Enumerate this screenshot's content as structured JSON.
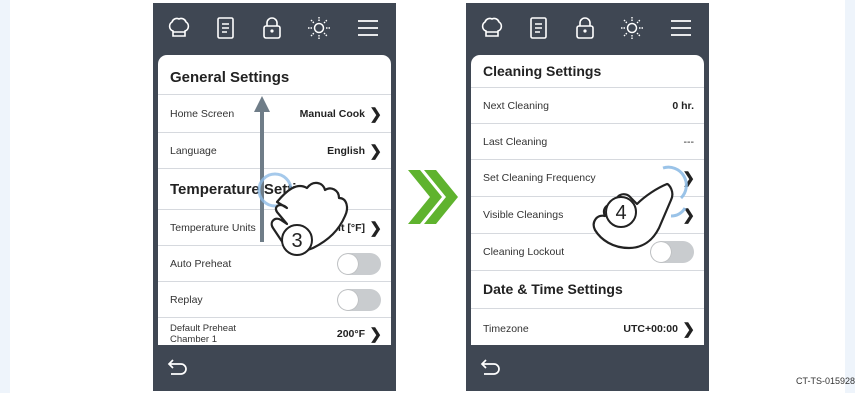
{
  "toolbar_icons": [
    "chef-hat-icon",
    "recipe-book-icon",
    "lock-icon",
    "brightness-icon",
    "menu-icon"
  ],
  "left_screen": {
    "general_header": "General Settings",
    "home_screen": {
      "label": "Home Screen",
      "value": "Manual Cook"
    },
    "language": {
      "label": "Language",
      "value": "English"
    },
    "temperature_header": "Temperature Settings",
    "temperature_units": {
      "label": "Temperature Units",
      "value": "heit [°F]"
    },
    "auto_preheat": {
      "label": "Auto Preheat",
      "on": false
    },
    "replay": {
      "label": "Replay",
      "on": false
    },
    "default_preheat": {
      "label": "Default Preheat\nChamber 1",
      "value": "200°F"
    },
    "step_number": "3"
  },
  "right_screen": {
    "cleaning_header": "Cleaning Settings",
    "next_cleaning": {
      "label": "Next Cleaning",
      "value": "0 hr."
    },
    "last_cleaning": {
      "label": "Last Cleaning",
      "value": "---"
    },
    "set_cleaning_frequency": {
      "label": "Set Cleaning Frequency"
    },
    "visible_cleanings": {
      "label": "Visible Cleanings"
    },
    "cleaning_lockout": {
      "label": "Cleaning Lockout",
      "on": false
    },
    "datetime_header": "Date & Time Settings",
    "timezone": {
      "label": "Timezone",
      "value": "UTC+00:00"
    },
    "step_number": "4"
  },
  "caption": "CT-TS-015928",
  "colors": {
    "frame": "#3f4753",
    "accent_green": "#5fb32e",
    "toggle_off": "#c9cccf",
    "touch_ring": "#8fbce6"
  }
}
